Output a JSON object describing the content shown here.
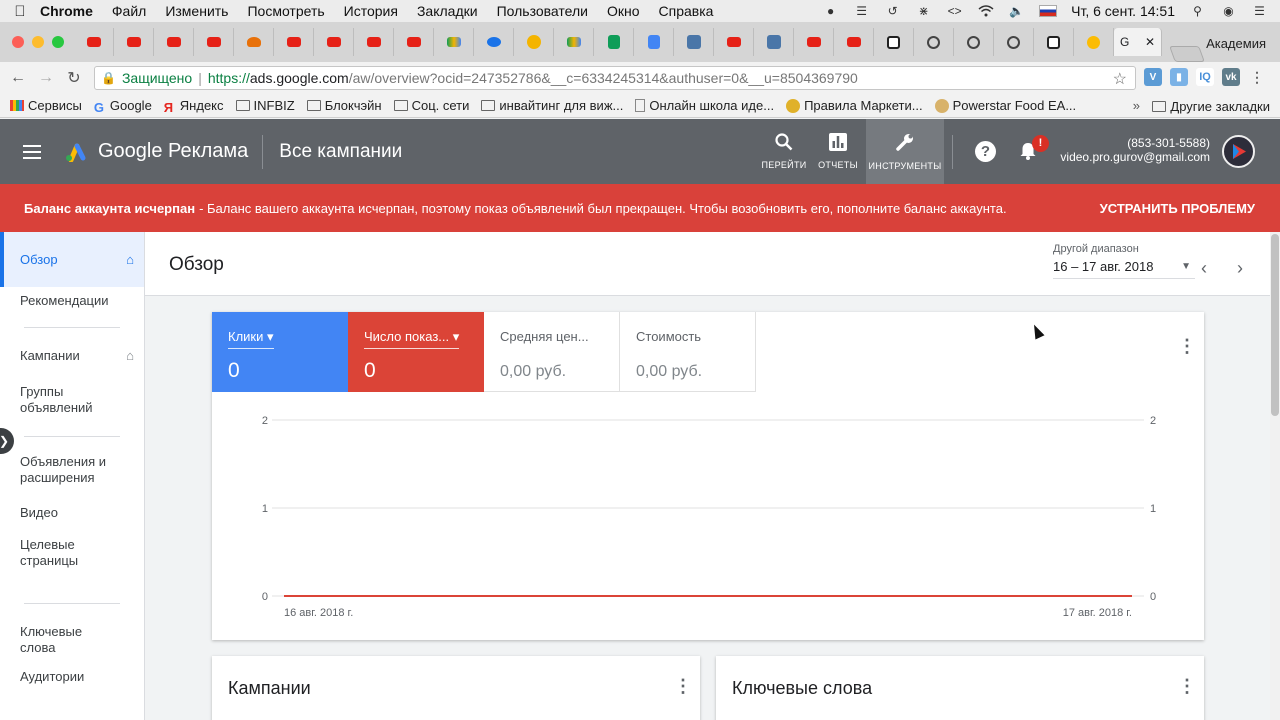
{
  "menubar": {
    "app": "Chrome",
    "items": [
      "Файл",
      "Изменить",
      "Посмотреть",
      "История",
      "Закладки",
      "Пользователи",
      "Окно",
      "Справка"
    ],
    "clock": "Чт, 6 сент.  14:51"
  },
  "browser": {
    "active_tab_letter": "G",
    "profile": "Академия",
    "secure_label": "Защищено",
    "url_proto": "https://",
    "url_host": "ads.google.com",
    "url_path": "/aw/overview?ocid=247352786&__c=6334245314&authuser=0&__u=8504369790"
  },
  "bookmarks": {
    "items": [
      "Сервисы",
      "Google",
      "Яндекс",
      "INFBIZ",
      "Блокчэйн",
      "Соц. сети",
      "инвайтинг для виж...",
      "Онлайн школа иде...",
      "Правила Маркети...",
      "Powerstar Food EA..."
    ],
    "more": "»",
    "other": "Другие закладки"
  },
  "header": {
    "brand": "Google Реклама",
    "title": "Все кампании",
    "btn_go": "ПЕРЕЙТИ",
    "btn_reports": "ОТЧЕТЫ",
    "btn_tools": "ИНСТРУМЕНТЫ",
    "help": "?",
    "badge": "!",
    "phone": "(853-301-5588)",
    "email": "video.pro.gurov@gmail.com"
  },
  "alert": {
    "bold": "Баланс аккаунта исчерпан",
    "text": "- Баланс вашего аккаунта исчерпан, поэтому показ объявлений был прекращен. Чтобы возобновить его, пополните баланс аккаунта.",
    "action": "УСТРАНИТЬ ПРОБЛЕМУ"
  },
  "sidebar": {
    "overview": "Обзор",
    "recommendations": "Рекомендации",
    "campaigns": "Кампании",
    "adgroups": "Группы объявлений",
    "ads": "Объявления и расширения",
    "video": "Видео",
    "landing": "Целевые страницы",
    "keywords": "Ключевые слова",
    "audiences": "Аудитории"
  },
  "page": {
    "title": "Обзор",
    "range_label": "Другой диапазон",
    "range_value": "16 – 17 авг. 2018"
  },
  "metrics": {
    "clicks_label": "Клики",
    "clicks_value": "0",
    "impr_label": "Число показ...",
    "impr_value": "0",
    "avgcpc_label": "Средняя цен...",
    "avgcpc_value": "0,00 руб.",
    "cost_label": "Стоимость",
    "cost_value": "0,00 руб."
  },
  "chart_data": {
    "type": "line",
    "x": [
      "16 авг. 2018 г.",
      "17 авг. 2018 г."
    ],
    "series": [
      {
        "values": [
          0,
          0
        ],
        "color": "#db4437"
      }
    ],
    "y_ticks_left": [
      "0",
      "1",
      "2"
    ],
    "y_ticks_right": [
      "0",
      "1",
      "2"
    ],
    "ylim": [
      0,
      2
    ],
    "grid": true
  },
  "cards": {
    "campaigns": "Кампании",
    "keywords": "Ключевые слова"
  },
  "colors": {
    "header_bg": "#5f6368",
    "alert_bg": "#d9413a",
    "clicks_blue": "#4285f4",
    "impr_red": "#db4437",
    "accent": "#1a73e8"
  }
}
